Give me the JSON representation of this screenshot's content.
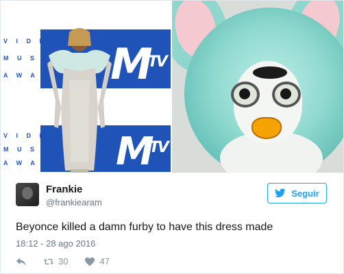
{
  "media": {
    "left_image": {
      "backdrop_line1": "V I D E O",
      "backdrop_line2": "M U S I C",
      "backdrop_line3": "A W A R D S",
      "brand": "M",
      "brand_sub": "TV"
    }
  },
  "tweet": {
    "author_name": "Frankie",
    "author_handle": "@frankiearam",
    "follow_label": "Seguir",
    "text": "Beyonce killed a damn furby to have this dress made",
    "timestamp": "18:12 - 28 ago 2016",
    "retweets": "30",
    "likes": "47"
  },
  "colors": {
    "accent": "#1da1f2",
    "muted": "#657786",
    "icon": "#8899a6",
    "vma_blue": "#1f53b8",
    "furby_teal": "#8fd7cc"
  },
  "icons": {
    "follow": "bird-icon",
    "reply": "reply-icon",
    "retweet": "retweet-icon",
    "like": "heart-icon"
  }
}
